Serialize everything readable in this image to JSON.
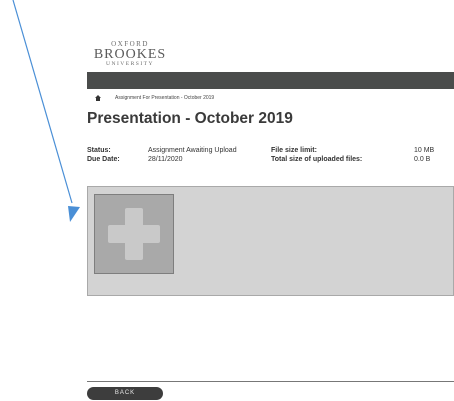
{
  "logo": {
    "line1": "OXFORD",
    "line2": "BROOKES",
    "line3": "UNIVERSITY"
  },
  "breadcrumb": {
    "icon": "home-icon",
    "text": "Assignment For Presentation - October 2019"
  },
  "page": {
    "title": "Presentation - October 2019"
  },
  "details": {
    "status_label": "Status:",
    "status_value": "Assignment Awaiting Upload",
    "due_label": "Due Date:",
    "due_value": "28/11/2020",
    "size_limit_label": "File size limit:",
    "size_limit_value": "10 MB",
    "total_size_label": "Total size of uploaded files:",
    "total_size_value": "0.0 B"
  },
  "upload": {
    "icon": "plus-icon"
  },
  "footer": {
    "back_label": "BACK"
  },
  "colors": {
    "navbar": "#4a4c4b",
    "panel": "#d3d3d3",
    "upload_tile": "#a9a9a9",
    "annotation_arrow": "#4a8fd6"
  }
}
